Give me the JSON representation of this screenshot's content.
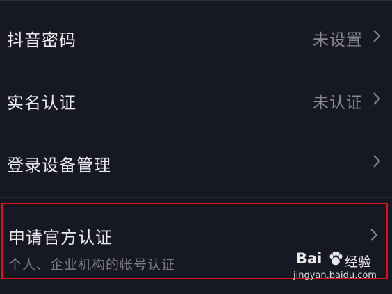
{
  "settings": {
    "items": [
      {
        "label": "抖音密码",
        "value": "未设置"
      },
      {
        "label": "实名认证",
        "value": "未认证"
      },
      {
        "label": "登录设备管理",
        "value": ""
      },
      {
        "label": "申请官方认证",
        "sublabel": "个人、企业机构的帐号认证"
      }
    ]
  },
  "icons": {
    "chevron": "chevron-right-icon"
  },
  "colors": {
    "background": "#161823",
    "text_primary": "#ebebed",
    "text_secondary": "#8a8b91",
    "highlight_border": "#e0101a"
  },
  "watermark": {
    "brand": "Bai",
    "brand_suffix": "经验",
    "url": "jingyan.baidu.com"
  }
}
